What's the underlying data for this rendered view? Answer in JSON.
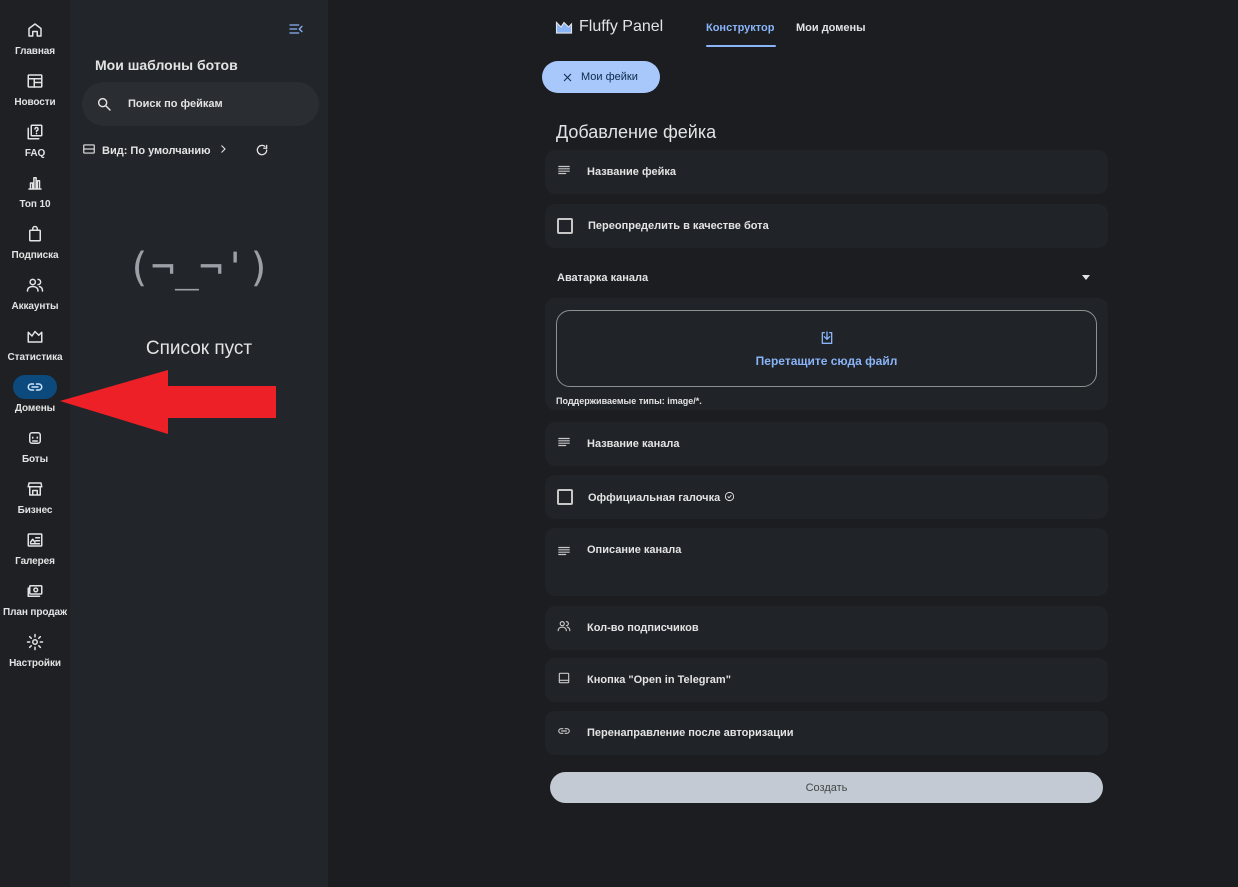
{
  "nav": {
    "items": [
      {
        "label": "Главная",
        "icon": "home-icon"
      },
      {
        "label": "Новости",
        "icon": "news-icon"
      },
      {
        "label": "FAQ",
        "icon": "faq-icon"
      },
      {
        "label": "Топ 10",
        "icon": "bar-chart-icon"
      },
      {
        "label": "Подписка",
        "icon": "shopping-bag-icon"
      },
      {
        "label": "Аккаунты",
        "icon": "users-icon"
      },
      {
        "label": "Статистика",
        "icon": "analytics-icon"
      },
      {
        "label": "Домены",
        "icon": "link-icon",
        "active": true
      },
      {
        "label": "Боты",
        "icon": "bot-icon"
      },
      {
        "label": "Бизнес",
        "icon": "store-icon"
      },
      {
        "label": "Галерея",
        "icon": "gallery-icon"
      },
      {
        "label": "План продаж",
        "icon": "money-icon"
      },
      {
        "label": "Настройки",
        "icon": "gear-icon"
      }
    ]
  },
  "templates": {
    "title": "Мои шаблоны ботов",
    "search_placeholder": "Поиск по фейкам",
    "view_label": "Вид: По умолчанию",
    "empty_face": "(¬_¬')",
    "empty_text": "Список пуст"
  },
  "header": {
    "logo_text": "Fluffy Panel",
    "tabs": [
      {
        "label": "Конструктор",
        "active": true
      },
      {
        "label": "Мои домены",
        "active": false
      }
    ]
  },
  "chip": {
    "label": "Мои фейки"
  },
  "form": {
    "title": "Добавление фейка",
    "fake_name": "Название фейка",
    "override_bot": "Переопределить в качестве бота",
    "avatar_label": "Аватарка канала",
    "drop_label": "Перетащите сюда файл",
    "supported_types": "Поддерживаемые типы: image/*.",
    "channel_name": "Название канала",
    "official_check": "Оффициальная галочка",
    "channel_description": "Описание канала",
    "subscribers": "Кол-во подписчиков",
    "telegram_button": "Кнопка \"Open in Telegram\"",
    "redirect": "Перенаправление после авторизации",
    "submit": "Создать"
  },
  "colors": {
    "accent": "#8ab4f8",
    "active_nav": "#0c4a7e",
    "chip_bg": "#a8c7fa",
    "annotation_arrow": "#ee2027"
  }
}
